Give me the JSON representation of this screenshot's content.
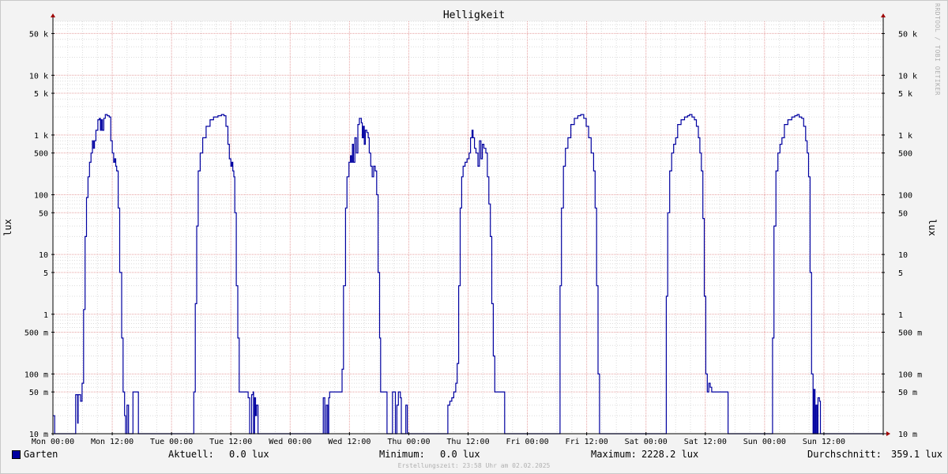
{
  "chart_data": {
    "type": "line",
    "title": "Helligkeit",
    "ylabel_left": "lux",
    "ylabel_right": "lux",
    "y_scale": "log",
    "ylim": [
      10,
      80000
    ],
    "y_ticks": [
      {
        "value": 10,
        "label": "10 m"
      },
      {
        "value": 50,
        "label": "50 m"
      },
      {
        "value": 100,
        "label": "100 m"
      },
      {
        "value": 500,
        "label": "500 m"
      },
      {
        "value": 1000,
        "label": "1"
      },
      {
        "value": 5000,
        "label": "5"
      },
      {
        "value": 10000,
        "label": "10"
      },
      {
        "value": 50000,
        "label": "50"
      },
      {
        "value": 100000,
        "label": "100"
      },
      {
        "value": 500000,
        "label": "500"
      },
      {
        "value": 1000000,
        "label": "1 k"
      },
      {
        "value": 5000000,
        "label": "5 k"
      },
      {
        "value": 10000000,
        "label": "10 k"
      },
      {
        "value": 50000000,
        "label": "50 k"
      }
    ],
    "y_unit_note": "tick values expressed in millilux",
    "x_ticks": [
      "Mon 00:00",
      "Mon 12:00",
      "Tue 00:00",
      "Tue 12:00",
      "Wed 00:00",
      "Wed 12:00",
      "Thu 00:00",
      "Thu 12:00",
      "Fri 00:00",
      "Fri 12:00",
      "Sat 00:00",
      "Sat 12:00",
      "Sun 00:00",
      "Sun 12:00"
    ],
    "xlim_hours": [
      0,
      168
    ],
    "grid": true,
    "series": [
      {
        "name": "Garten",
        "color": "#0000a0",
        "points_hours_millilux": [
          [
            0,
            20
          ],
          [
            0.3,
            20
          ],
          [
            0.35,
            10
          ],
          [
            4.5,
            10
          ],
          [
            4.6,
            45
          ],
          [
            4.9,
            45
          ],
          [
            5,
            15
          ],
          [
            5.1,
            45
          ],
          [
            5.5,
            45
          ],
          [
            5.6,
            35
          ],
          [
            5.8,
            35
          ],
          [
            5.9,
            70
          ],
          [
            6.2,
            1200
          ],
          [
            6.5,
            20000
          ],
          [
            6.8,
            90000
          ],
          [
            7.1,
            200000
          ],
          [
            7.4,
            350000
          ],
          [
            7.7,
            500000
          ],
          [
            8,
            800000
          ],
          [
            8.2,
            600000
          ],
          [
            8.4,
            800000
          ],
          [
            8.7,
            1200000
          ],
          [
            9.1,
            1800000
          ],
          [
            9.4,
            1900000
          ],
          [
            9.6,
            1200000
          ],
          [
            9.8,
            1800000
          ],
          [
            10,
            1200000
          ],
          [
            10.3,
            1900000
          ],
          [
            10.6,
            2200000
          ],
          [
            11,
            2100000
          ],
          [
            11.4,
            2000000
          ],
          [
            11.7,
            800000
          ],
          [
            12,
            500000
          ],
          [
            12.3,
            350000
          ],
          [
            12.5,
            400000
          ],
          [
            12.7,
            300000
          ],
          [
            12.9,
            250000
          ],
          [
            13.2,
            60000
          ],
          [
            13.5,
            5000
          ],
          [
            13.9,
            400
          ],
          [
            14.2,
            50
          ],
          [
            14.5,
            20
          ],
          [
            14.7,
            10
          ],
          [
            15,
            30
          ],
          [
            15.3,
            10
          ],
          [
            16,
            10
          ],
          [
            16.2,
            50
          ],
          [
            17.2,
            50
          ],
          [
            17.3,
            10
          ],
          [
            28.3,
            10
          ],
          [
            28.5,
            50
          ],
          [
            28.8,
            1500
          ],
          [
            29.1,
            30000
          ],
          [
            29.4,
            250000
          ],
          [
            29.8,
            500000
          ],
          [
            30.3,
            900000
          ],
          [
            31,
            1400000
          ],
          [
            31.8,
            1800000
          ],
          [
            32.5,
            2000000
          ],
          [
            33.4,
            2100000
          ],
          [
            34.1,
            2200000
          ],
          [
            34.6,
            2100000
          ],
          [
            35,
            1400000
          ],
          [
            35.4,
            700000
          ],
          [
            35.7,
            400000
          ],
          [
            36,
            300000
          ],
          [
            36.2,
            350000
          ],
          [
            36.4,
            250000
          ],
          [
            36.6,
            200000
          ],
          [
            36.8,
            50000
          ],
          [
            37.1,
            3000
          ],
          [
            37.4,
            400
          ],
          [
            37.7,
            50
          ],
          [
            39.2,
            50
          ],
          [
            39.5,
            40
          ],
          [
            39.8,
            10
          ],
          [
            40.2,
            45
          ],
          [
            40.5,
            50
          ],
          [
            40.6,
            10
          ],
          [
            40.8,
            40
          ],
          [
            41,
            20
          ],
          [
            41.2,
            30
          ],
          [
            41.5,
            10
          ],
          [
            54.5,
            10
          ],
          [
            54.7,
            40
          ],
          [
            55,
            10
          ],
          [
            55.3,
            30
          ],
          [
            55.6,
            10
          ],
          [
            55.8,
            40
          ],
          [
            56,
            50
          ],
          [
            58.2,
            50
          ],
          [
            58.5,
            120
          ],
          [
            58.8,
            3000
          ],
          [
            59.2,
            60000
          ],
          [
            59.5,
            200000
          ],
          [
            59.9,
            350000
          ],
          [
            60.2,
            450000
          ],
          [
            60.4,
            350000
          ],
          [
            60.6,
            700000
          ],
          [
            60.8,
            350000
          ],
          [
            61.1,
            900000
          ],
          [
            61.4,
            500000
          ],
          [
            61.7,
            1500000
          ],
          [
            62,
            1900000
          ],
          [
            62.4,
            1600000
          ],
          [
            62.6,
            900000
          ],
          [
            62.8,
            1400000
          ],
          [
            63,
            700000
          ],
          [
            63.2,
            1200000
          ],
          [
            63.5,
            1100000
          ],
          [
            63.8,
            900000
          ],
          [
            64,
            500000
          ],
          [
            64.3,
            300000
          ],
          [
            64.6,
            200000
          ],
          [
            64.9,
            300000
          ],
          [
            65.2,
            250000
          ],
          [
            65.5,
            100000
          ],
          [
            65.8,
            5000
          ],
          [
            66.1,
            400
          ],
          [
            66.3,
            50
          ],
          [
            67.5,
            50
          ],
          [
            67.6,
            10
          ],
          [
            68.5,
            10
          ],
          [
            68.7,
            50
          ],
          [
            69.3,
            10
          ],
          [
            69.6,
            30
          ],
          [
            69.9,
            50
          ],
          [
            70.3,
            40
          ],
          [
            70.5,
            10
          ],
          [
            71.2,
            10
          ],
          [
            71.4,
            30
          ],
          [
            71.7,
            10
          ],
          [
            79.7,
            10
          ],
          [
            79.9,
            30
          ],
          [
            80.3,
            35
          ],
          [
            80.7,
            40
          ],
          [
            81.1,
            50
          ],
          [
            81.5,
            70
          ],
          [
            81.8,
            150
          ],
          [
            82.1,
            3000
          ],
          [
            82.4,
            60000
          ],
          [
            82.7,
            200000
          ],
          [
            83,
            300000
          ],
          [
            83.4,
            350000
          ],
          [
            83.8,
            400000
          ],
          [
            84.2,
            500000
          ],
          [
            84.5,
            900000
          ],
          [
            84.8,
            1200000
          ],
          [
            85,
            900000
          ],
          [
            85.3,
            600000
          ],
          [
            85.6,
            500000
          ],
          [
            86,
            300000
          ],
          [
            86.3,
            800000
          ],
          [
            86.6,
            400000
          ],
          [
            86.9,
            700000
          ],
          [
            87.2,
            600000
          ],
          [
            87.6,
            500000
          ],
          [
            87.9,
            200000
          ],
          [
            88.2,
            70000
          ],
          [
            88.5,
            20000
          ],
          [
            88.8,
            1500
          ],
          [
            89.1,
            200
          ],
          [
            89.4,
            50
          ],
          [
            91.2,
            50
          ],
          [
            91.4,
            10
          ],
          [
            102.3,
            10
          ],
          [
            102.6,
            3000
          ],
          [
            102.9,
            60000
          ],
          [
            103.3,
            300000
          ],
          [
            103.7,
            600000
          ],
          [
            104.2,
            900000
          ],
          [
            104.8,
            1500000
          ],
          [
            105.5,
            1900000
          ],
          [
            106.2,
            2100000
          ],
          [
            106.8,
            2200000
          ],
          [
            107.4,
            1900000
          ],
          [
            107.9,
            1400000
          ],
          [
            108.4,
            900000
          ],
          [
            108.9,
            500000
          ],
          [
            109.4,
            250000
          ],
          [
            109.7,
            60000
          ],
          [
            110,
            3000
          ],
          [
            110.3,
            100
          ],
          [
            110.6,
            10
          ],
          [
            123.8,
            10
          ],
          [
            124.1,
            2000
          ],
          [
            124.4,
            50000
          ],
          [
            124.8,
            250000
          ],
          [
            125.2,
            500000
          ],
          [
            125.6,
            700000
          ],
          [
            126,
            900000
          ],
          [
            126.4,
            1500000
          ],
          [
            127.1,
            1800000
          ],
          [
            127.8,
            2000000
          ],
          [
            128.4,
            2100000
          ],
          [
            128.8,
            2200000
          ],
          [
            129.3,
            2000000
          ],
          [
            129.8,
            1800000
          ],
          [
            130.2,
            1400000
          ],
          [
            130.6,
            900000
          ],
          [
            130.9,
            500000
          ],
          [
            131.2,
            250000
          ],
          [
            131.5,
            40000
          ],
          [
            131.8,
            2000
          ],
          [
            132.1,
            100
          ],
          [
            132.4,
            50
          ],
          [
            132.7,
            70
          ],
          [
            133,
            60
          ],
          [
            133.3,
            50
          ],
          [
            136.4,
            50
          ],
          [
            136.6,
            10
          ],
          [
            145.3,
            10
          ],
          [
            145.6,
            400
          ],
          [
            145.9,
            30000
          ],
          [
            146.3,
            250000
          ],
          [
            146.7,
            500000
          ],
          [
            147.1,
            700000
          ],
          [
            147.5,
            900000
          ],
          [
            148,
            1500000
          ],
          [
            148.7,
            1800000
          ],
          [
            149.5,
            2000000
          ],
          [
            150.1,
            2100000
          ],
          [
            150.6,
            2200000
          ],
          [
            151,
            2000000
          ],
          [
            151.5,
            1900000
          ],
          [
            151.9,
            1400000
          ],
          [
            152.3,
            800000
          ],
          [
            152.6,
            500000
          ],
          [
            152.9,
            200000
          ],
          [
            153.2,
            5000
          ],
          [
            153.5,
            100
          ],
          [
            153.8,
            10
          ],
          [
            154,
            55
          ],
          [
            154.2,
            10
          ],
          [
            154.4,
            30
          ],
          [
            154.6,
            10
          ],
          [
            154.8,
            40
          ],
          [
            155.1,
            35
          ],
          [
            155.3,
            10
          ],
          [
            168,
            10
          ]
        ]
      }
    ],
    "legend": {
      "label": "Garten",
      "color": "#0000a0",
      "position": "bottom-left"
    },
    "stats": {
      "current_label": "Aktuell:",
      "current_value": "0.0 lux",
      "min_label": "Minimum:",
      "min_value": "0.0 lux",
      "max_label": "Maximum:",
      "max_value": "2228.2 lux",
      "avg_label": "Durchschnitt:",
      "avg_value": "359.1 lux"
    },
    "footer": "Erstellungszeit: 23:58 Uhr am 02.02.2025",
    "watermark": "RRDTOOL / TOBI OETIKER",
    "colors": {
      "background": "#f3f3f3",
      "canvas": "#ffffff",
      "major_grid": "#e6a0a0",
      "minor_grid": "#dcdcdc",
      "line": "#0000a0",
      "axis": "#000000",
      "arrow": "#a00000"
    }
  }
}
